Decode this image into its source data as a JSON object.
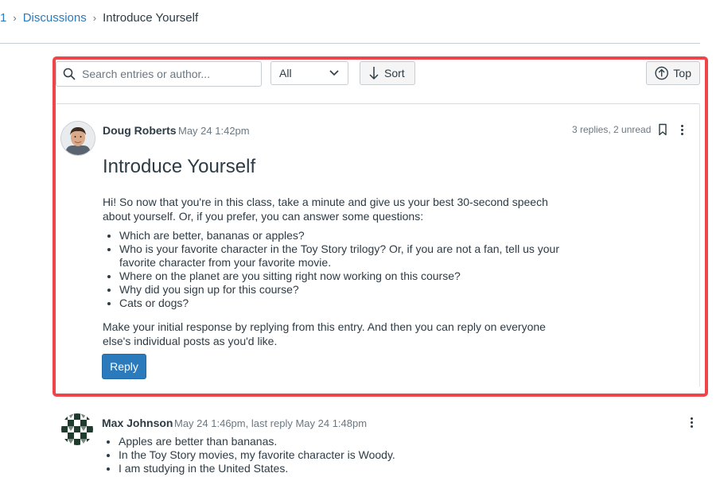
{
  "breadcrumb": {
    "items": [
      {
        "label": "1"
      },
      {
        "label": "Discussions"
      },
      {
        "label": "Introduce Yourself"
      }
    ]
  },
  "toolbar": {
    "search_placeholder": "Search entries or author...",
    "filter_value": "All",
    "sort_label": "Sort",
    "top_label": "Top"
  },
  "topic": {
    "author": "Doug Roberts",
    "timestamp": "May 24 1:42pm",
    "reply_summary": "3 replies, 2 unread",
    "title": "Introduce Yourself",
    "intro": "Hi! So now that you're in this class, take a minute and give us your best 30-second speech about yourself. Or, if you prefer, you can answer some questions:",
    "questions": [
      "Which are better, bananas or apples?",
      "Who is your favorite character in the Toy Story trilogy? Or, if you are not a fan, tell us your favorite character from your favorite movie.",
      "Where on the planet are you sitting right now working on this course?",
      "Why did you sign up for this course?",
      "Cats or dogs?"
    ],
    "closing": "Make your initial response by replying from this entry. And then you can reply on everyone else's individual posts as you'd like.",
    "reply_label": "Reply"
  },
  "reply": {
    "author": "Max Johnson",
    "timestamp": "May 24 1:46pm, last reply May 24 1:48pm",
    "lines": [
      "Apples are better than bananas.",
      "In the Toy Story movies, my favorite character is Woody.",
      "I am studying in the United States."
    ]
  },
  "colors": {
    "link": "#2b7abc",
    "primary_button": "#2b7abc",
    "highlight_border": "#f0444b",
    "text": "#2d3b45",
    "muted": "#6b7780"
  },
  "icons": {
    "search": "search-icon",
    "chevron": "chevron-down-icon",
    "sort": "arrow-down-icon",
    "top": "arrow-up-circle-icon",
    "bookmark": "bookmark-icon",
    "more": "kebab-menu-icon"
  }
}
